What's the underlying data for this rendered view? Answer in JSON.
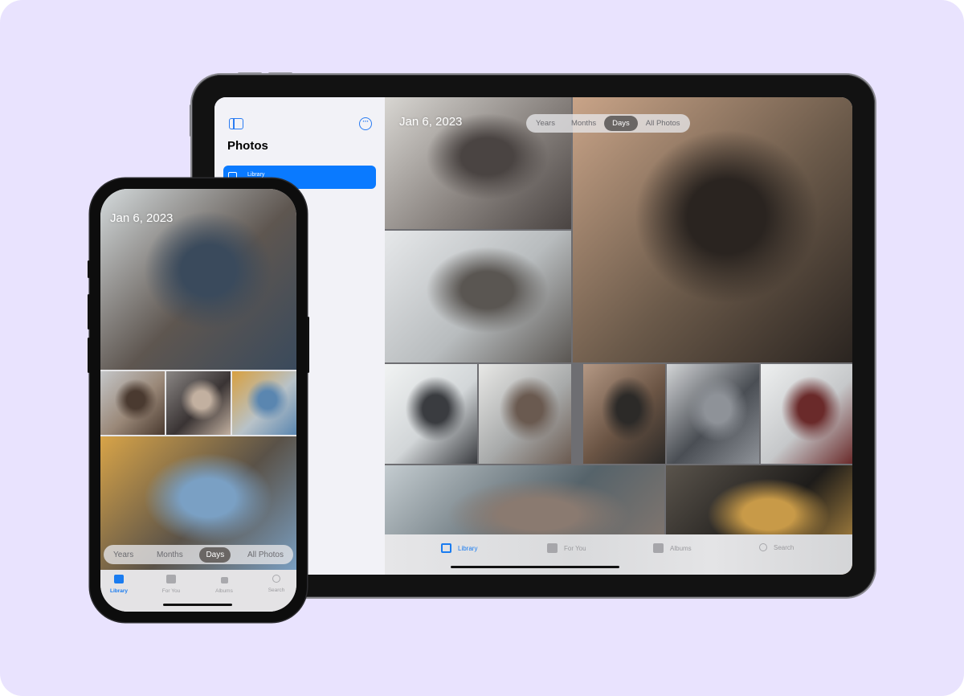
{
  "ipad": {
    "sidebar": {
      "title": "Photos",
      "toggle_icon": "sidebar-toggle-icon",
      "more_icon": "ellipsis-circle-icon",
      "items": [
        {
          "label": "Library",
          "icon": "photo-library-icon",
          "selected": true
        }
      ]
    },
    "main": {
      "date_heading": "Jan 6, 2023",
      "view_segments": [
        {
          "label": "Years",
          "active": false
        },
        {
          "label": "Months",
          "active": false
        },
        {
          "label": "Days",
          "active": true
        },
        {
          "label": "All Photos",
          "active": false
        }
      ],
      "photos": [
        {
          "name": "woman-seated-sofa-wine",
          "colors": [
            "#8a8480",
            "#d8d6d2",
            "#4a4442"
          ]
        },
        {
          "name": "portrait-close-up",
          "colors": [
            "#6b5a4a",
            "#c9a488",
            "#2a2420"
          ]
        },
        {
          "name": "woman-drinking-window",
          "colors": [
            "#b8bcbe",
            "#e6e8ea",
            "#5a5652"
          ]
        },
        {
          "name": "woman-at-window-snow",
          "colors": [
            "#d2d6d8",
            "#f1f3f3",
            "#3a3c40"
          ]
        },
        {
          "name": "woman-on-bed",
          "colors": [
            "#a8aaaa",
            "#e8e8e6",
            "#6a5a50"
          ]
        },
        {
          "name": "woman-with-glass",
          "colors": [
            "#6a5444",
            "#b49884",
            "#2c2a28"
          ]
        },
        {
          "name": "decanter-on-table",
          "colors": [
            "#4a4e54",
            "#d2d4d6",
            "#8e9298"
          ]
        },
        {
          "name": "pouring-wine",
          "colors": [
            "#c6c8ca",
            "#eef0f0",
            "#6a2a2a"
          ]
        },
        {
          "name": "hand-reaching",
          "colors": [
            "#56636a",
            "#c4ccd0",
            "#8a7a70"
          ]
        },
        {
          "name": "glass-and-honey",
          "colors": [
            "#1e1c1a",
            "#5a544c",
            "#c89a48"
          ]
        }
      ]
    },
    "tab_bar": [
      {
        "label": "Library",
        "icon": "photo-library-icon",
        "active": true
      },
      {
        "label": "For You",
        "icon": "for-you-icon",
        "active": false
      },
      {
        "label": "Albums",
        "icon": "albums-icon",
        "active": false
      },
      {
        "label": "Search",
        "icon": "search-icon",
        "active": false
      }
    ]
  },
  "iphone": {
    "date_heading": "Jan 6, 2023",
    "view_segments": [
      {
        "label": "Years",
        "active": false
      },
      {
        "label": "Months",
        "active": false
      },
      {
        "label": "Days",
        "active": true
      },
      {
        "label": "All Photos",
        "active": false
      }
    ],
    "photos": [
      {
        "name": "couple-on-car-snow",
        "colors": [
          "#5e5650",
          "#d4dadc",
          "#3a4a5c"
        ]
      },
      {
        "name": "pouring-thermos",
        "colors": [
          "#9a8878",
          "#c4c6c8",
          "#4a3a30"
        ]
      },
      {
        "name": "holding-cups",
        "colors": [
          "#3a3434",
          "#8a8684",
          "#c2b0a0"
        ]
      },
      {
        "name": "woman-yellow-hat",
        "colors": [
          "#b8c2c8",
          "#d8a040",
          "#5a86b0"
        ]
      },
      {
        "name": "woman-yellow-hat-close",
        "colors": [
          "#5a5248",
          "#d8a448",
          "#7aa0c4"
        ]
      }
    ],
    "tab_bar": [
      {
        "label": "Library",
        "icon": "photo-library-icon",
        "active": true
      },
      {
        "label": "For You",
        "icon": "for-you-icon",
        "active": false
      },
      {
        "label": "Albums",
        "icon": "albums-icon",
        "active": false
      },
      {
        "label": "Search",
        "icon": "search-icon",
        "active": false
      }
    ]
  }
}
